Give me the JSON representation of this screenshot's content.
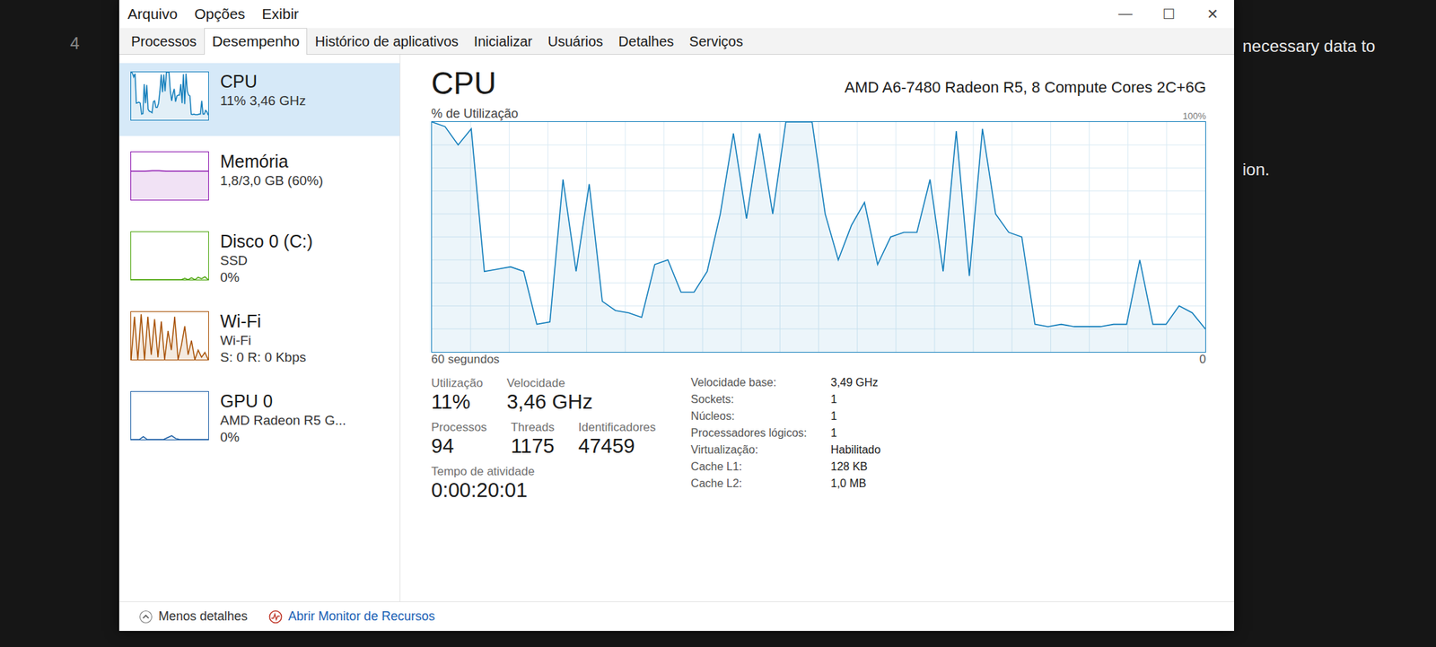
{
  "desktop": {
    "texts": [
      "4",
      "necessary data to",
      "ion."
    ]
  },
  "window": {
    "menu": [
      "Arquivo",
      "Opções",
      "Exibir"
    ],
    "controls": [
      "—",
      "☐",
      "✕"
    ]
  },
  "tabs": [
    {
      "label": "Processos",
      "selected": false
    },
    {
      "label": "Desempenho",
      "selected": true
    },
    {
      "label": "Histórico de aplicativos",
      "selected": false
    },
    {
      "label": "Inicializar",
      "selected": false
    },
    {
      "label": "Usuários",
      "selected": false
    },
    {
      "label": "Detalhes",
      "selected": false
    },
    {
      "label": "Serviços",
      "selected": false
    }
  ],
  "sidebar": {
    "items": [
      {
        "name": "CPU",
        "lines": [
          "11% 3,46 GHz"
        ],
        "selected": true,
        "color": "#117dbb",
        "values": [
          100,
          98,
          90,
          97,
          35,
          36,
          37,
          35,
          12,
          13,
          75,
          35,
          73,
          22,
          18,
          17,
          15,
          38,
          40,
          26,
          26,
          35,
          60,
          95,
          58,
          95,
          60,
          100,
          100,
          100,
          60,
          40,
          55,
          65,
          38,
          50,
          52,
          52,
          75,
          35,
          96,
          33,
          97,
          60,
          52,
          50,
          12,
          11,
          12,
          11,
          11,
          11,
          12,
          12,
          40,
          12,
          12,
          20,
          17,
          10
        ]
      },
      {
        "name": "Memória",
        "lines": [
          "1,8/3,0 GB (60%)"
        ],
        "selected": false,
        "color": "#8b12ae",
        "values": [
          60,
          60,
          60,
          61,
          61,
          60,
          60,
          60,
          60,
          60,
          60,
          60
        ]
      },
      {
        "name": "Disco 0 (C:)",
        "lines": [
          "SSD",
          "0%"
        ],
        "selected": false,
        "color": "#4da60c",
        "values": [
          0,
          0,
          0,
          0,
          0,
          0,
          0,
          0,
          0,
          0,
          0,
          0,
          0,
          0,
          0,
          0,
          3,
          0,
          4,
          0,
          5,
          2,
          6,
          0
        ]
      },
      {
        "name": "Wi-Fi",
        "lines": [
          "Wi-Fi",
          "S: 0 R: 0 Kbps"
        ],
        "selected": false,
        "color": "#a74f01",
        "values": [
          0,
          90,
          0,
          95,
          0,
          90,
          10,
          85,
          5,
          80,
          0,
          60,
          20,
          90,
          0,
          30,
          70,
          10,
          40,
          0,
          20,
          5,
          15,
          0
        ]
      },
      {
        "name": "GPU 0",
        "lines": [
          "AMD Radeon R5 G...",
          "0%"
        ],
        "selected": false,
        "color": "#1d5fa5",
        "values": [
          0,
          0,
          0,
          6,
          0,
          0,
          0,
          0,
          0,
          4,
          8,
          2,
          0,
          0,
          0,
          0,
          0,
          0,
          0,
          0
        ]
      }
    ]
  },
  "detail": {
    "title": "CPU",
    "model": "AMD A6-7480 Radeon R5, 8 Compute Cores 2C+6G",
    "chart": {
      "label": "% de Utilização",
      "max_label": "100%",
      "time_label": "60 segundos",
      "min_label": "0",
      "max": 100,
      "values": [
        100,
        98,
        90,
        97,
        35,
        36,
        37,
        35,
        12,
        13,
        75,
        35,
        73,
        22,
        18,
        17,
        15,
        38,
        40,
        26,
        26,
        35,
        60,
        95,
        58,
        95,
        60,
        100,
        100,
        100,
        60,
        40,
        55,
        65,
        38,
        50,
        52,
        52,
        75,
        35,
        96,
        33,
        97,
        60,
        52,
        50,
        12,
        11,
        12,
        11,
        11,
        11,
        12,
        12,
        40,
        12,
        12,
        20,
        17,
        10
      ]
    },
    "stat_rows": [
      [
        {
          "label": "Utilização",
          "value": "11%"
        },
        {
          "label": "Velocidade",
          "value": "3,46 GHz"
        }
      ],
      [
        {
          "label": "Processos",
          "value": "94"
        },
        {
          "label": "Threads",
          "value": "1175"
        },
        {
          "label": "Identificadores",
          "value": "47459"
        }
      ],
      [
        {
          "label": "Tempo de atividade",
          "value": "0:00:20:01"
        }
      ]
    ],
    "specs": [
      {
        "label": "Velocidade base:",
        "value": "3,49 GHz"
      },
      {
        "label": "Sockets:",
        "value": "1"
      },
      {
        "label": "Núcleos:",
        "value": "1"
      },
      {
        "label": "Processadores lógicos:",
        "value": "1"
      },
      {
        "label": "Virtualização:",
        "value": "Habilitado"
      },
      {
        "label": "Cache L1:",
        "value": "128 KB"
      },
      {
        "label": "Cache L2:",
        "value": "1,0 MB"
      }
    ]
  },
  "footer": {
    "less": "Menos detalhes",
    "monitor": "Abrir Monitor de Recursos"
  }
}
